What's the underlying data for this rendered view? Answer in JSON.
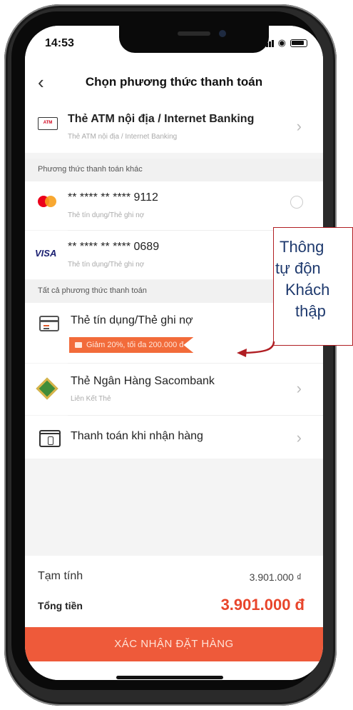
{
  "status_bar": {
    "time": "14:53"
  },
  "header": {
    "title": "Chọn phương thức thanh toán"
  },
  "atm": {
    "icon_text": "ATM",
    "title": "Thẻ ATM nội địa / Internet Banking",
    "subtitle": "Thẻ ATM nội địa / Internet Banking"
  },
  "other_methods": {
    "header": "Phương thức thanh toán khác",
    "cards": [
      {
        "brand": "mastercard",
        "number": "** **** ** **** 9112",
        "subtitle": "Thẻ tín dụng/Thẻ ghi nợ"
      },
      {
        "brand": "visa",
        "brand_label": "VISA",
        "number": "** **** ** **** 0689",
        "subtitle": "Thẻ tín dụng/Thẻ ghi nợ"
      }
    ]
  },
  "all_methods": {
    "header": "Tất cả phương thức thanh toán",
    "credit": {
      "title": "Thẻ tín dụng/Thẻ ghi nợ",
      "promo": "Giảm 20%, tối đa 200.000 đ"
    },
    "sacombank": {
      "title": "Thẻ Ngân Hàng Sacombank",
      "subtitle": "Liên Kết Thẻ"
    },
    "cod": {
      "title": "Thanh toán khi nhận hàng"
    }
  },
  "summary": {
    "subtotal_label": "Tạm tính",
    "subtotal_value": "3.901.000 ₫",
    "total_label": "Tổng tiền",
    "total_value": "3.901.000 đ"
  },
  "confirm_button": "XÁC NHẬN ĐẶT HÀNG",
  "annotation": {
    "lines": [
      "Thông",
      "tự độn",
      "Khách",
      "thập"
    ]
  },
  "colors": {
    "accent": "#ee5a3a",
    "total": "#e8452b",
    "annotation_border": "#b01e23",
    "annotation_text": "#1f3a6e"
  }
}
